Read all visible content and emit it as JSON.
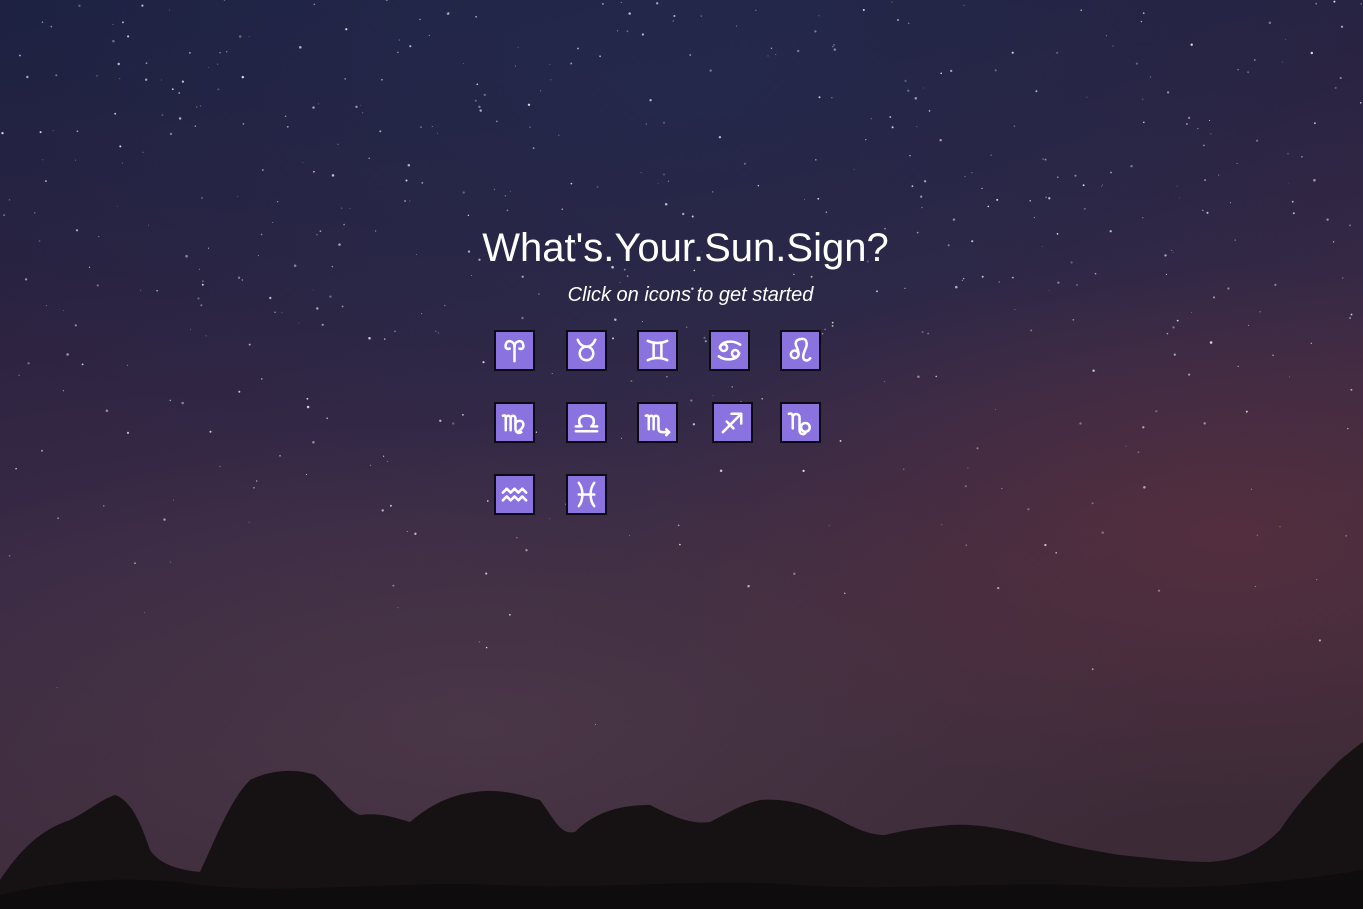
{
  "header": {
    "title": "What's.Your.Sun.Sign?",
    "subtitle": "Click on icons to get started"
  },
  "theme": {
    "button_color": "#8a72df",
    "button_border": "#0c0b14",
    "text_color": "#ffffff"
  },
  "zodiac_signs": [
    {
      "name": "Aries",
      "icon": "aries-icon",
      "glyph": "♈"
    },
    {
      "name": "Taurus",
      "icon": "taurus-icon",
      "glyph": "♉"
    },
    {
      "name": "Gemini",
      "icon": "gemini-icon",
      "glyph": "♊"
    },
    {
      "name": "Cancer",
      "icon": "cancer-icon",
      "glyph": "♋"
    },
    {
      "name": "Leo",
      "icon": "leo-icon",
      "glyph": "♌"
    },
    {
      "name": "Virgo",
      "icon": "virgo-icon",
      "glyph": "♍"
    },
    {
      "name": "Libra",
      "icon": "libra-icon",
      "glyph": "♎"
    },
    {
      "name": "Scorpio",
      "icon": "scorpio-icon",
      "glyph": "♏"
    },
    {
      "name": "Sagittarius",
      "icon": "sagittarius-icon",
      "glyph": "♐"
    },
    {
      "name": "Capricorn",
      "icon": "capricorn-icon",
      "glyph": "♑"
    },
    {
      "name": "Aquarius",
      "icon": "aquarius-icon",
      "glyph": "♒"
    },
    {
      "name": "Pisces",
      "icon": "pisces-icon",
      "glyph": "♓"
    }
  ]
}
